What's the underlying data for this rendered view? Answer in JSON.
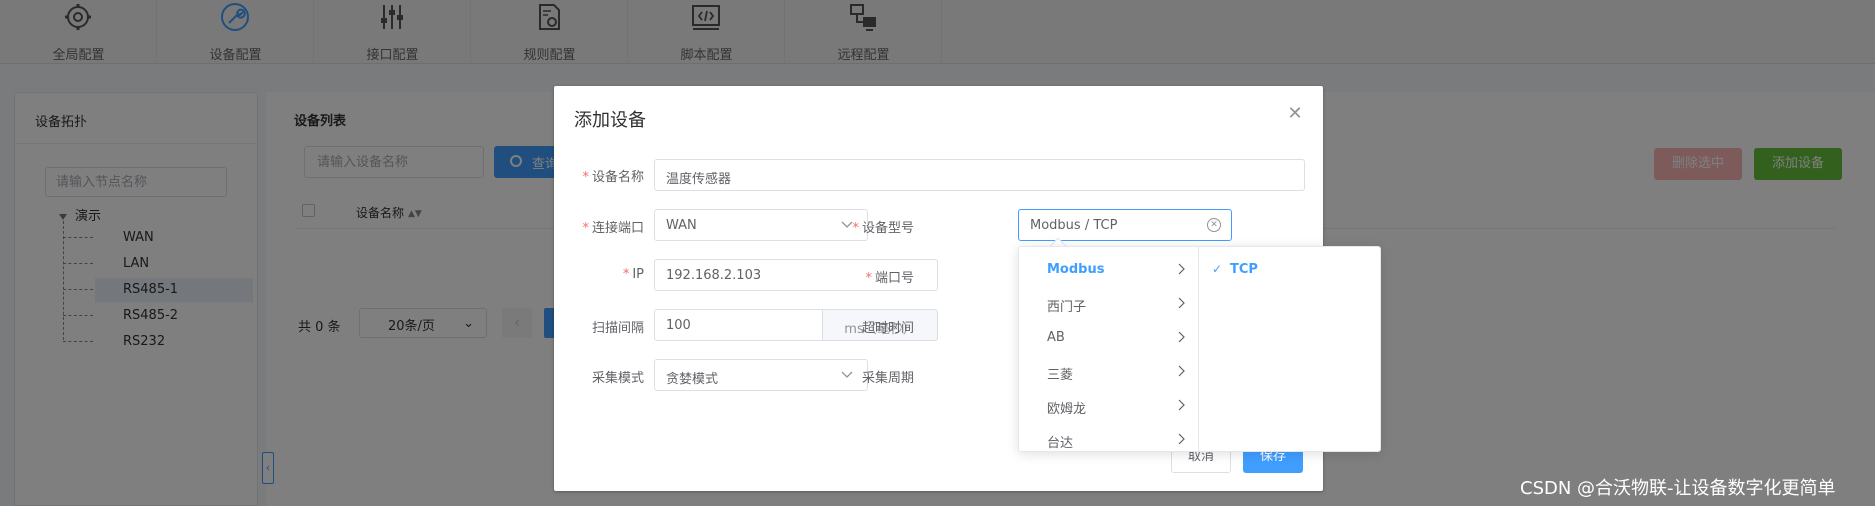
{
  "nav": {
    "items": [
      {
        "label": "全局配置",
        "icon": "gear-icon"
      },
      {
        "label": "设备配置",
        "icon": "wrench-icon"
      },
      {
        "label": "接口配置",
        "icon": "sliders-icon"
      },
      {
        "label": "规则配置",
        "icon": "document-gear-icon"
      },
      {
        "label": "脚本配置",
        "icon": "code-icon"
      },
      {
        "label": "远程配置",
        "icon": "network-icon"
      }
    ],
    "active_index": 1
  },
  "topology": {
    "title": "设备拓扑",
    "search_placeholder": "请输入节点名称",
    "root": "演示",
    "nodes": [
      "WAN",
      "LAN",
      "RS485-1",
      "RS485-2",
      "RS232"
    ],
    "selected_node": "RS485-1"
  },
  "device_list": {
    "title": "设备列表",
    "search_placeholder": "请输入设备名称",
    "query_label": "查询",
    "delete_selected_label": "删除选中",
    "add_device_label": "添加设备",
    "column_name": "设备名称",
    "total": "共 0 条",
    "page_size": "20条/页",
    "prev_icon": "chevron-left-icon"
  },
  "dialog": {
    "title": "添加设备",
    "device_name_label": "设备名称",
    "device_name_value": "温度传感器",
    "port_label": "连接端口",
    "port_value": "WAN",
    "model_label": "设备型号",
    "model_value": "Modbus / TCP",
    "ip_label": "IP",
    "ip_value": "192.168.2.103",
    "port_no_label": "端口号",
    "scan_label": "扫描间隔",
    "scan_value": "100",
    "scan_unit": "ms（毫秒）",
    "timeout_label": "超时时间",
    "mode_label": "采集模式",
    "mode_value": "贪婪模式",
    "period_label": "采集周期",
    "cancel_label": "取消",
    "save_label": "保存"
  },
  "cascader": {
    "level1": [
      "Modbus",
      "西门子",
      "AB",
      "三菱",
      "欧姆龙",
      "台达"
    ],
    "active_level1": "Modbus",
    "level2": [
      "TCP"
    ],
    "selected_level2": "TCP"
  },
  "watermark": "CSDN @合沃物联-让设备数字化更简单",
  "colors": {
    "primary": "#409eff",
    "success": "#67c23a",
    "danger_light": "#fab6b6",
    "required": "#f56c6c"
  }
}
